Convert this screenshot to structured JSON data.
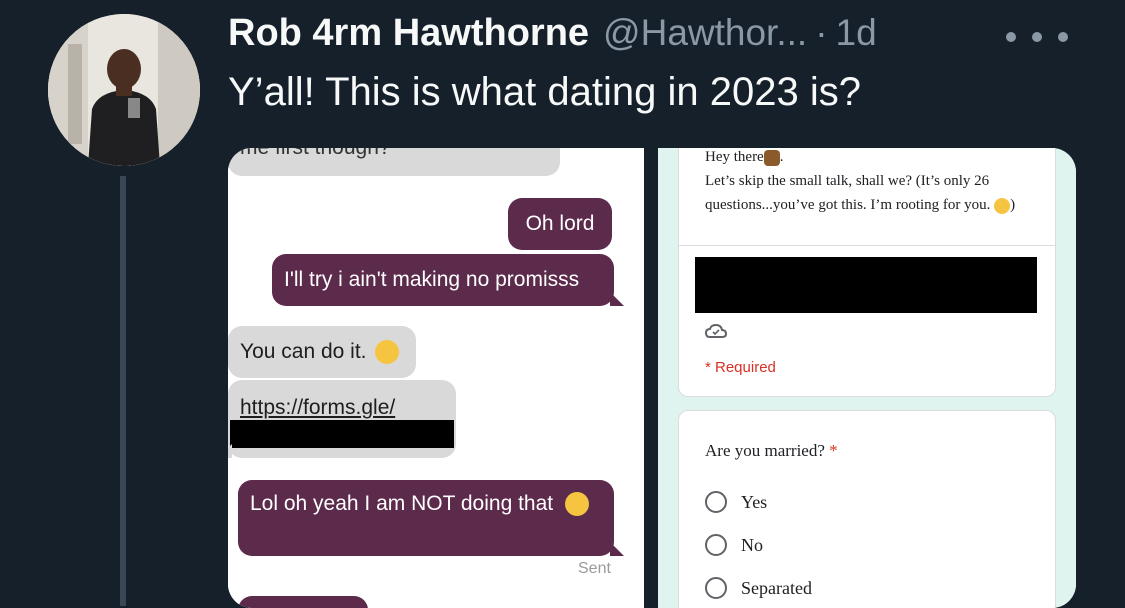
{
  "tweet": {
    "display_name": "Rob 4rm Hawthorne",
    "handle": "@Hawthor...",
    "separator": "·",
    "time": "1d",
    "text": "Y’all! This is what dating in 2023 is?"
  },
  "chat": {
    "top_fragment": "me first though?",
    "messages": [
      {
        "text": "Oh lord",
        "side": "sent"
      },
      {
        "text": "I'll try i ain't making no promisss",
        "side": "sent"
      },
      {
        "text": "You can do it.",
        "side": "received",
        "emoji": "winking-face-icon"
      },
      {
        "text": "https://forms.gle/",
        "side": "received"
      },
      {
        "text": "Lol oh yeah I am NOT doing that",
        "side": "sent",
        "emoji": "tears-of-joy-icon"
      }
    ],
    "status": "Sent"
  },
  "form": {
    "intro_line1": "Hey there",
    "intro_line2": "Let’s skip the small talk, shall we? (It’s only 26 questions...you’ve got this. I’m rooting for you.",
    "intro_end": ")",
    "required_note": "* Required",
    "question": "Are you married?",
    "required_star": "*",
    "options": [
      "Yes",
      "No",
      "Separated"
    ]
  }
}
